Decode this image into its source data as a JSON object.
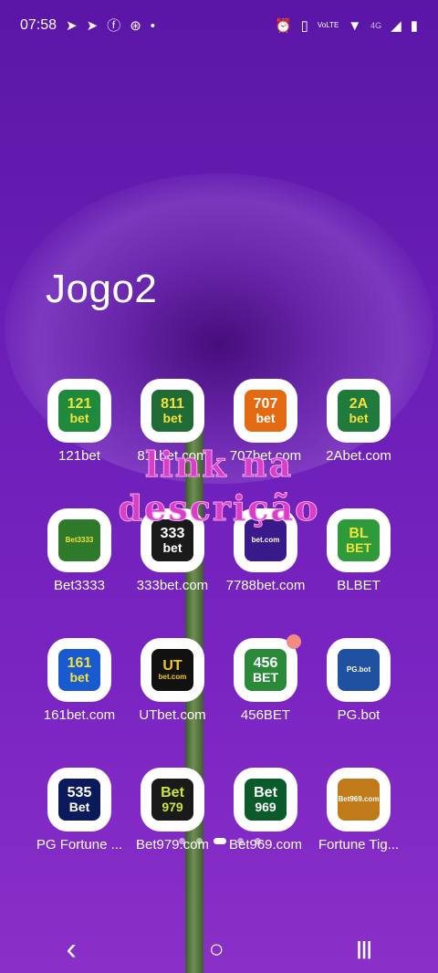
{
  "status_bar": {
    "time": "07:58",
    "left_icons": [
      "telegram-icon",
      "telegram-icon",
      "facebook-icon",
      "app-icon",
      "dot-icon"
    ],
    "right_icons": [
      "alarm-icon",
      "vibrate-icon",
      "volte-icon",
      "wifi-icon",
      "signal-icon",
      "battery-icon"
    ],
    "network_label": "4G",
    "volte_label": "VoLTE"
  },
  "folder": {
    "title": "Jogo2"
  },
  "apps": [
    {
      "label": "121bet",
      "icon_line1": "121",
      "icon_line2": "bet",
      "bg": "#1f8a3c",
      "fg": "#f2e23a"
    },
    {
      "label": "811bet.com",
      "icon_line1": "811",
      "icon_line2": "bet",
      "bg": "#1f6a35",
      "fg": "#f2e23a"
    },
    {
      "label": "707bet.com",
      "icon_line1": "707",
      "icon_line2": "bet",
      "bg": "#e46a12",
      "fg": "#ffffff"
    },
    {
      "label": "2Abet.com",
      "icon_line1": "2A",
      "icon_line2": "bet",
      "bg": "#1f7a3c",
      "fg": "#f2e23a"
    },
    {
      "label": "Bet3333",
      "icon_line1": "",
      "icon_line2": "Bet3333",
      "bg": "#2f7a2a",
      "fg": "#f2e23a"
    },
    {
      "label": "333bet.com",
      "icon_line1": "333",
      "icon_line2": "bet",
      "bg": "#1a1a1a",
      "fg": "#ffffff"
    },
    {
      "label": "7788bet.com",
      "icon_line1": "",
      "icon_line2": "bet.com",
      "bg": "#3a1a8a",
      "fg": "#ffffff"
    },
    {
      "label": "BLBET",
      "icon_line1": "BL",
      "icon_line2": "BET",
      "bg": "#2e9a3a",
      "fg": "#f2e23a"
    },
    {
      "label": "161bet.com",
      "icon_line1": "161",
      "icon_line2": "bet",
      "bg": "#1a5ad0",
      "fg": "#f2e23a"
    },
    {
      "label": "UTbet.com",
      "icon_line1": "UT",
      "icon_line2": "bet.com",
      "bg": "#111111",
      "fg": "#f2c81a"
    },
    {
      "label": "456BET",
      "icon_line1": "456",
      "icon_line2": "BET",
      "bg": "#2a8a3a",
      "fg": "#ffffff"
    },
    {
      "label": "PG.bot",
      "icon_line1": "",
      "icon_line2": "PG.bot",
      "bg": "#2050a0",
      "fg": "#ffffff"
    },
    {
      "label": "PG Fortune ...",
      "icon_line1": "535",
      "icon_line2": "Bet",
      "bg": "#0a1a5a",
      "fg": "#ffffff"
    },
    {
      "label": "Bet979.com",
      "icon_line1": "Bet",
      "icon_line2": "979",
      "bg": "#1a1a1a",
      "fg": "#c8e83a"
    },
    {
      "label": "Bet969.com",
      "icon_line1": "Bet",
      "icon_line2": "969",
      "bg": "#0a5a2a",
      "fg": "#ffffff"
    },
    {
      "label": "Fortune Tig...",
      "icon_line1": "",
      "icon_line2": "Bet969.com",
      "bg": "#c07a1a",
      "fg": "#ffffff"
    }
  ],
  "overlay": {
    "line1": "link na",
    "line2": "descrição"
  },
  "page_indicator": {
    "count": 5,
    "active": 2
  },
  "nav_bar": {
    "back": "‹",
    "home": "○",
    "recents": "|||"
  }
}
